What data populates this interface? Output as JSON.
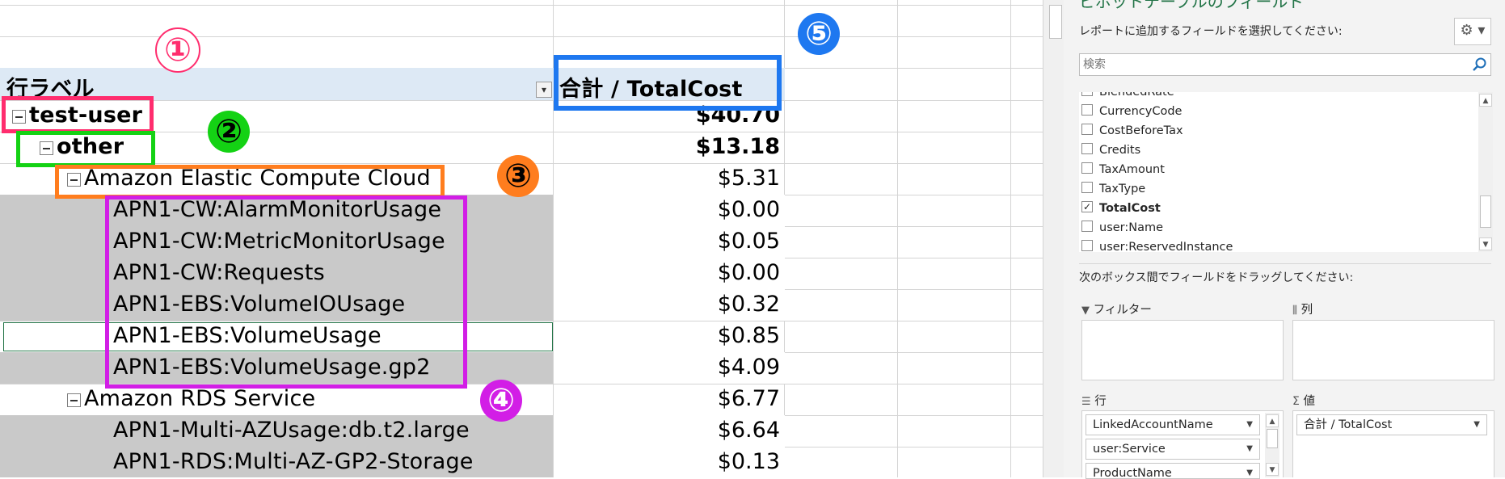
{
  "annotations": [
    "①",
    "②",
    "③",
    "④",
    "⑤"
  ],
  "colors": {
    "red": "#ff2d6e",
    "green": "#14d214",
    "orange": "#ff7d1e",
    "magenta": "#d21ee6",
    "blue": "#1e78f0",
    "excel_green": "#217346",
    "header_bg": "#dde9f5",
    "shade": "#c9c9c9"
  },
  "pivot": {
    "row_label_header": "行ラベル",
    "value_header": "合計 / TotalCost",
    "rows": [
      {
        "label": "test-user",
        "value": "$40.70",
        "bold": true,
        "collapse": true
      },
      {
        "label": "other",
        "value": "$13.18",
        "bold": true,
        "collapse": true
      },
      {
        "label": "Amazon Elastic Compute Cloud",
        "value": "$5.31",
        "collapse": true
      },
      {
        "label": "APN1-CW:AlarmMonitorUsage",
        "value": "$0.00"
      },
      {
        "label": "APN1-CW:MetricMonitorUsage",
        "value": "$0.05"
      },
      {
        "label": "APN1-CW:Requests",
        "value": "$0.00"
      },
      {
        "label": "APN1-EBS:VolumeIOUsage",
        "value": "$0.32"
      },
      {
        "label": "APN1-EBS:VolumeUsage",
        "value": "$0.85"
      },
      {
        "label": "APN1-EBS:VolumeUsage.gp2",
        "value": "$4.09"
      },
      {
        "label": "Amazon RDS Service",
        "value": "$6.77",
        "collapse": true
      },
      {
        "label": "APN1-Multi-AZUsage:db.t2.large",
        "value": "$6.64"
      },
      {
        "label": "APN1-RDS:Multi-AZ-GP2-Storage",
        "value": "$0.13"
      }
    ]
  },
  "field_panel": {
    "title": "ピボットテーブルのフィールド",
    "instruction": "レポートに追加するフィールドを選択してください:",
    "search_placeholder": "検索",
    "fields": [
      {
        "name": "BlendedRate",
        "checked": false
      },
      {
        "name": "CurrencyCode",
        "checked": false
      },
      {
        "name": "CostBeforeTax",
        "checked": false
      },
      {
        "name": "Credits",
        "checked": false
      },
      {
        "name": "TaxAmount",
        "checked": false
      },
      {
        "name": "TaxType",
        "checked": false
      },
      {
        "name": "TotalCost",
        "checked": true
      },
      {
        "name": "user:Name",
        "checked": false
      },
      {
        "name": "user:ReservedInstance",
        "checked": false
      }
    ],
    "drag_instruction": "次のボックス間でフィールドをドラッグしてください:",
    "filter_label": "フィルター",
    "columns_label": "列",
    "rows_label": "行",
    "values_label": "値",
    "row_fields": [
      "LinkedAccountName",
      "user:Service",
      "ProductName"
    ],
    "value_fields": [
      "合計 / TotalCost"
    ]
  }
}
